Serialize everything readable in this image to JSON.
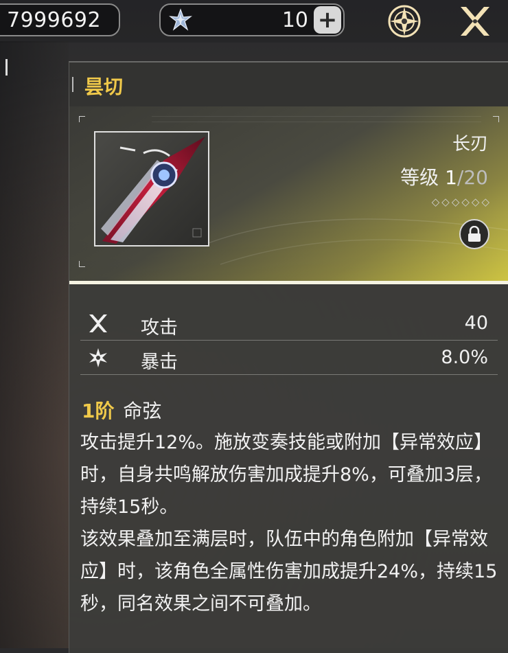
{
  "topbar": {
    "coins": "7999692",
    "gems": "10",
    "plus_label": "+",
    "icons": [
      "gem-icon",
      "compass-icon",
      "crossed-swords-icon"
    ]
  },
  "weapon": {
    "name": "昙切",
    "type": "长刃",
    "level_label": "等级",
    "level_current": "1",
    "level_separator": "/",
    "level_max": "20",
    "rank_diamonds": 6,
    "locked": true
  },
  "stats": [
    {
      "icon": "attack-icon",
      "name": "攻击",
      "value": "40"
    },
    {
      "icon": "crit-icon",
      "name": "暴击",
      "value": "8.0%"
    }
  ],
  "passive": {
    "rank": "1阶",
    "name": "命弦",
    "description": "攻击提升12%。施放变奏技能或附加【异常效应】时，自身共鸣解放伤害加成提升8%，可叠加3层，持续15秒。\n该效果叠加至满层时，队伍中的角色附加【异常效应】时，该角色全属性伤害加成提升24%，持续15秒，同名效果之间不可叠加。"
  },
  "colors": {
    "accent_gold": "#f0c94a",
    "hero_glow": "#d9cf46"
  }
}
